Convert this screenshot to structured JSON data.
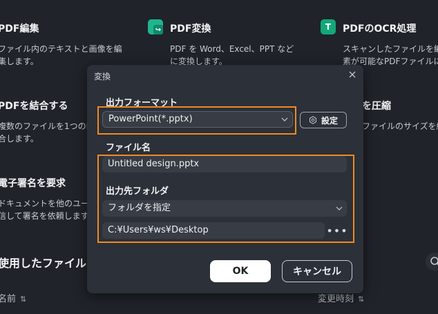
{
  "background": {
    "cards": [
      {
        "title": "PDF編集",
        "desc": "ファイル内のテキストと画像を編\n集します。"
      },
      {
        "title": "PDF変換",
        "desc": "PDF を Word、Excel、PPT など\nに変換します。",
        "icon": "convert-icon"
      },
      {
        "title": "PDFのOCR処理",
        "icon_letter": "T",
        "desc": "スキャンしたファイルを編\n素が可能なPDFファイルに"
      },
      {
        "title": "PDFを結合する",
        "desc": "複数のファイルを1つのP\n合します。"
      },
      {
        "title": "を圧縮",
        "desc": "ファイルのサイズを縮"
      },
      {
        "title": "電子署名を要求",
        "desc": "ドキュメントを他のユー\n信して署名を依頼します"
      }
    ],
    "recent_section": "使用したファイル",
    "columns": {
      "name": "名前",
      "modified": "変更時刻"
    }
  },
  "dialog": {
    "title": "変換",
    "output_format_label": "出力フォーマット",
    "output_format_value": "PowerPoint(*.pptx)",
    "settings_label": "設定",
    "file_name_label": "ファイル名",
    "file_name_value": "Untitled design.pptx",
    "output_folder_label": "出力先フォルダ",
    "folder_option": "フォルダを指定",
    "folder_path": "C:¥Users¥ws¥Desktop",
    "more_label": "•••",
    "ok_label": "OK",
    "cancel_label": "キャンセル"
  },
  "colors": {
    "highlight": "#f08a24",
    "convert_icon": "#1fb58f",
    "ocr_icon": "#13a779"
  }
}
